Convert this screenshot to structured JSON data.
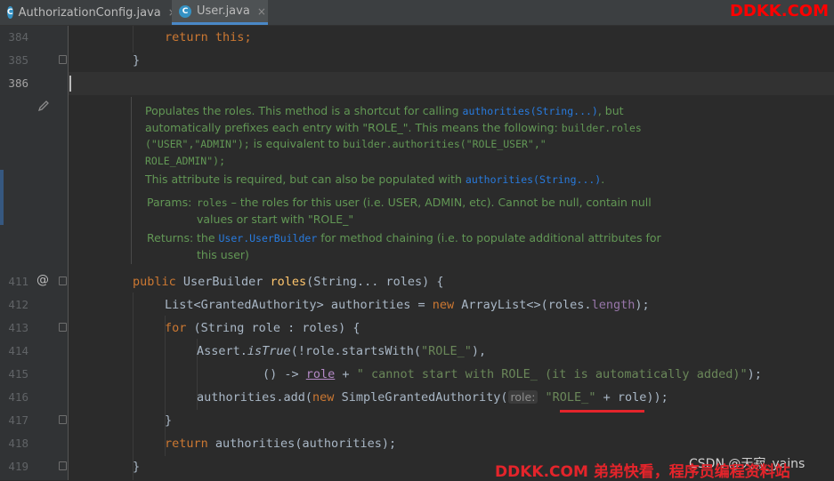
{
  "tabs": [
    {
      "icon": "C",
      "label": "AuthorizationConfig.java",
      "close": "×",
      "active": false
    },
    {
      "icon": "C",
      "label": "User.java",
      "close": "×",
      "active": true
    }
  ],
  "watermark_top": "DDKK.COM",
  "gutter": {
    "line_numbers": {
      "l384": "384",
      "l385": "385",
      "l386": "386",
      "l411": "411",
      "l412": "412",
      "l413": "413",
      "l414": "414",
      "l415": "415",
      "l416": "416",
      "l417": "417",
      "l418": "418",
      "l419": "419"
    },
    "override_marker": "@"
  },
  "code": {
    "l384": {
      "kw1": "return",
      "kw2": "this",
      "rest": ";"
    },
    "l385": {
      "text": "}"
    },
    "l411": {
      "kw": "public",
      "type": "UserBuilder",
      "method": "roles",
      "rest": "(String... roles) {"
    },
    "l412": {
      "a": "List<GrantedAuthority> authorities = ",
      "kw": "new",
      "b": " ArrayList<>(roles.",
      "field": "length",
      "c": ");"
    },
    "l413": {
      "kw": "for",
      "rest": " (String role : roles) {"
    },
    "l414": {
      "a": "Assert.",
      "method": "isTrue",
      "b": "(!role.startsWith(",
      "str": "\"ROLE_\"",
      "c": "),"
    },
    "l415": {
      "a": "() -> ",
      "var": "role",
      "b": " + ",
      "str": "\" cannot start with ROLE_ (it is automatically added)\"",
      "c": ");"
    },
    "l416": {
      "a": "authorities.add(",
      "kw": "new",
      "b": " SimpleGrantedAuthority(",
      "hint": "role:",
      "str": "\"ROLE_\"",
      "c": " + role));"
    },
    "l417": {
      "text": "}"
    },
    "l418": {
      "kw": "return",
      "rest": " authorities(authorities);"
    },
    "l419": {
      "text": "}"
    }
  },
  "doc": {
    "p1_a": "Populates the roles. This method is a shortcut for calling ",
    "p1_code1": "authorities(String...)",
    "p1_b": ", but",
    "p1_c": "automatically prefixes each entry with \"ROLE_\". This means the following: ",
    "p1_code2": "builder.roles",
    "p1_code3": "(\"USER\",\"ADMIN\");",
    "p1_d": " is equivalent to ",
    "p1_code4": "builder.authorities(\"ROLE_USER\",\"",
    "p1_code5": "ROLE_ADMIN\");",
    "p2_a": "This attribute is required, but can also be populated with ",
    "p2_code": "authorities(String...)",
    "p2_b": ".",
    "params_label": "Params:",
    "params_code": "roles",
    "params_text1": " – the roles for this user (i.e. USER, ADMIN, etc). Cannot be null, contain null",
    "params_text2": "values or start with \"ROLE_\"",
    "returns_label": "Returns:",
    "returns_a": "the ",
    "returns_code": "User.UserBuilder",
    "returns_b": " for method chaining (i.e. to populate additional attributes for",
    "returns_c": "this user)"
  },
  "watermark_bottom": "DDKK.COM 弟弟快看，程序员编程资料站",
  "csdn_mark": "CSDN @天寂_yains",
  "colors": {
    "background": "#2b2b2b",
    "keyword": "#cc7832",
    "string": "#6a8759",
    "method": "#ffc66d",
    "doc_text": "#629755",
    "doc_link": "#287bde",
    "watermark": "#e4242b"
  }
}
